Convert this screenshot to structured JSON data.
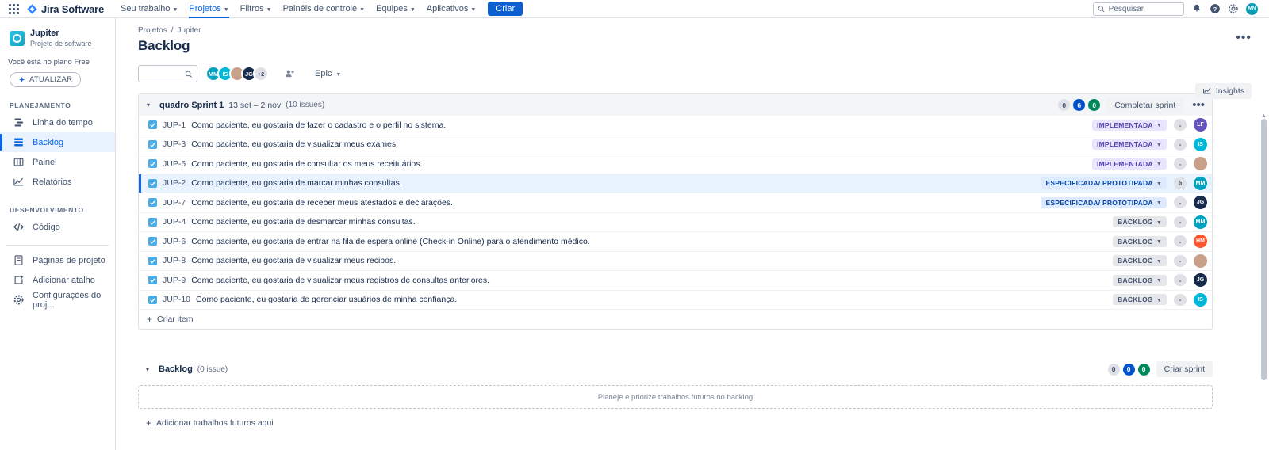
{
  "topnav": {
    "apps_label": "Apps",
    "brand": "Jira Software",
    "items": [
      {
        "label": "Seu trabalho",
        "has_caret": true,
        "active": false
      },
      {
        "label": "Projetos",
        "has_caret": true,
        "active": true
      },
      {
        "label": "Filtros",
        "has_caret": true,
        "active": false
      },
      {
        "label": "Painéis de controle",
        "has_caret": true,
        "active": false
      },
      {
        "label": "Equipes",
        "has_caret": true,
        "active": false
      },
      {
        "label": "Aplicativos",
        "has_caret": true,
        "active": false
      }
    ],
    "create_button": "Criar",
    "search_placeholder": "Pesquisar",
    "user_initials": "MN"
  },
  "sidebar": {
    "project_name": "Jupiter",
    "project_type": "Projeto de software",
    "plan_text": "Você está no plano Free",
    "upgrade_button": "ATUALIZAR",
    "sections": [
      {
        "label": "PLANEJAMENTO",
        "items": [
          {
            "label": "Linha do tempo",
            "icon": "timeline-icon",
            "active": false
          },
          {
            "label": "Backlog",
            "icon": "backlog-icon",
            "active": true
          },
          {
            "label": "Painel",
            "icon": "board-icon",
            "active": false
          },
          {
            "label": "Relatórios",
            "icon": "reports-icon",
            "active": false
          }
        ]
      },
      {
        "label": "DESENVOLVIMENTO",
        "items": [
          {
            "label": "Código",
            "icon": "code-icon",
            "active": false
          }
        ]
      }
    ],
    "footer_items": [
      {
        "label": "Páginas de projeto",
        "icon": "pages-icon"
      },
      {
        "label": "Adicionar atalho",
        "icon": "add-shortcut-icon"
      },
      {
        "label": "Configurações do proj...",
        "icon": "settings-icon"
      }
    ]
  },
  "main": {
    "breadcrumb": {
      "root": "Projetos",
      "separator": "/",
      "current": "Jupiter"
    },
    "page_title": "Backlog",
    "insights_button": "Insights",
    "toolbar": {
      "search_value": "",
      "search_placeholder": "",
      "avatars": [
        {
          "initials": "MM",
          "color": "#00a3bf"
        },
        {
          "initials": "IS",
          "color": "#00b8d9"
        },
        {
          "initials": "",
          "color": "#c9a18a"
        },
        {
          "initials": "JG",
          "color": "#172b4d"
        }
      ],
      "avatar_overflow": "+2",
      "epic_filter": "Epic"
    },
    "sprint": {
      "chevron": "▾",
      "name": "quadro Sprint 1",
      "dates": "13 set – 2 nov",
      "issue_count": "(10 issues)",
      "pills": [
        {
          "value": "0",
          "style": "grey"
        },
        {
          "value": "6",
          "style": "blue"
        },
        {
          "value": "0",
          "style": "green"
        }
      ],
      "complete_button": "Completar sprint",
      "more_label": "•••",
      "issues": [
        {
          "key": "JUP-1",
          "summary": "Como paciente, eu gostaria de fazer o cadastro e o perfil no sistema.",
          "status": "IMPLEMENTADA",
          "status_style": "impl",
          "estimate": "-",
          "avatar_initials": "LF",
          "avatar_color": "#6554c0",
          "selected": false
        },
        {
          "key": "JUP-3",
          "summary": "Como paciente, eu gostaria de visualizar meus exames.",
          "status": "IMPLEMENTADA",
          "status_style": "impl",
          "estimate": "-",
          "avatar_initials": "IS",
          "avatar_color": "#00b8d9",
          "selected": false
        },
        {
          "key": "JUP-5",
          "summary": "Como paciente, eu gostaria de consultar os meus receituários.",
          "status": "IMPLEMENTADA",
          "status_style": "impl",
          "estimate": "-",
          "avatar_initials": "",
          "avatar_color": "#c9a18a",
          "selected": false
        },
        {
          "key": "JUP-2",
          "summary": "Como paciente, eu gostaria de marcar minhas consultas.",
          "status": "ESPECIFICADA/ PROTOTIPADA",
          "status_style": "espec",
          "estimate": "6",
          "avatar_initials": "MM",
          "avatar_color": "#00a3bf",
          "selected": true
        },
        {
          "key": "JUP-7",
          "summary": "Como paciente, eu gostaria de receber meus atestados e declarações.",
          "status": "ESPECIFICADA/ PROTOTIPADA",
          "status_style": "espec",
          "estimate": "-",
          "avatar_initials": "JG",
          "avatar_color": "#172b4d",
          "selected": false
        },
        {
          "key": "JUP-4",
          "summary": "Como paciente, eu gostaria de desmarcar minhas consultas.",
          "status": "BACKLOG",
          "status_style": "backlog",
          "estimate": "-",
          "avatar_initials": "MM",
          "avatar_color": "#00a3bf",
          "selected": false
        },
        {
          "key": "JUP-6",
          "summary": "Como paciente, eu gostaria de entrar na fila de espera online (Check-in Online) para o atendimento médico.",
          "status": "BACKLOG",
          "status_style": "backlog",
          "estimate": "-",
          "avatar_initials": "HM",
          "avatar_color": "#ff5630",
          "selected": false
        },
        {
          "key": "JUP-8",
          "summary": "Como paciente, eu gostaria de visualizar meus recibos.",
          "status": "BACKLOG",
          "status_style": "backlog",
          "estimate": "-",
          "avatar_initials": "",
          "avatar_color": "#c9a18a",
          "selected": false
        },
        {
          "key": "JUP-9",
          "summary": "Como paciente, eu gostaria de visualizar meus registros de consultas anteriores.",
          "status": "BACKLOG",
          "status_style": "backlog",
          "estimate": "-",
          "avatar_initials": "JG",
          "avatar_color": "#172b4d",
          "selected": false
        },
        {
          "key": "JUP-10",
          "summary": "Como paciente, eu gostaria de gerenciar usuários de minha confiança.",
          "status": "BACKLOG",
          "status_style": "backlog",
          "estimate": "-",
          "avatar_initials": "IS",
          "avatar_color": "#00b8d9",
          "selected": false
        }
      ],
      "create_item": "Criar item"
    },
    "backlog": {
      "chevron": "▾",
      "title": "Backlog",
      "count": "(0 issue)",
      "pills": [
        {
          "value": "0",
          "style": "grey"
        },
        {
          "value": "0",
          "style": "blue"
        },
        {
          "value": "0",
          "style": "green"
        }
      ],
      "create_sprint_button": "Criar sprint",
      "empty_text": "Planeje e priorize trabalhos futuros no backlog",
      "add_future_work": "Adicionar trabalhos futuros aqui"
    }
  },
  "colors": {
    "accent": "#0c66e4",
    "brand_blue": "#0052cc",
    "green": "#00875a",
    "purple": "#5243aa",
    "selected_row": "#e9f2ff"
  }
}
